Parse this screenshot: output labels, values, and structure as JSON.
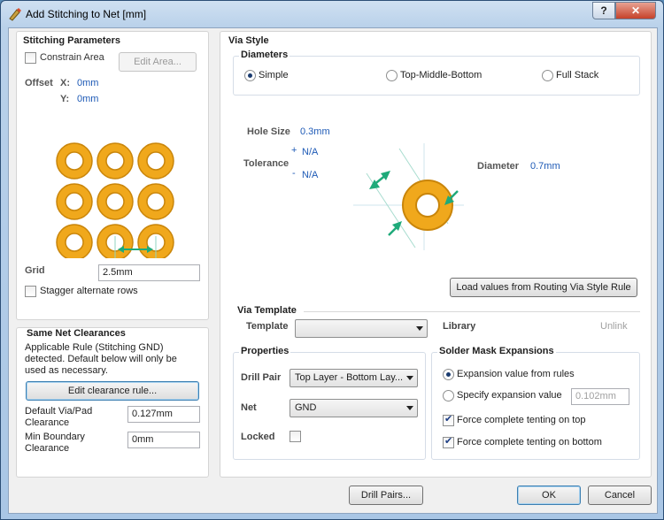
{
  "window": {
    "title": "Add Stitching to Net [mm]",
    "help_label": "?",
    "close_label": "✕"
  },
  "stitching": {
    "title": "Stitching Parameters",
    "constrain_area": "Constrain Area",
    "edit_area": "Edit Area...",
    "offset_label": "Offset",
    "x_label": "X:",
    "x_value": "0mm",
    "y_label": "Y:",
    "y_value": "0mm",
    "grid_label": "Grid",
    "grid_value": "2.5mm",
    "stagger": "Stagger alternate rows"
  },
  "clearances": {
    "title": "Same Net Clearances",
    "rule_text_1": "Applicable Rule (Stitching GND)",
    "rule_text_2": "detected. Default below will only be",
    "rule_text_3": "used as necessary.",
    "edit_rule": "Edit clearance rule...",
    "default_label_1": "Default Via/Pad",
    "default_label_2": "Clearance",
    "default_value": "0.127mm",
    "min_label_1": "Min Boundary",
    "min_label_2": "Clearance",
    "min_value": "0mm"
  },
  "via_style": {
    "title": "Via Style",
    "diameters_title": "Diameters",
    "simple": "Simple",
    "tmb": "Top-Middle-Bottom",
    "full": "Full Stack",
    "hole_size_label": "Hole Size",
    "hole_size_value": "0.3mm",
    "tolerance_label": "Tolerance",
    "tol_plus_sign": "+",
    "tol_plus_value": "N/A",
    "tol_minus_sign": "-",
    "tol_minus_value": "N/A",
    "diameter_label": "Diameter",
    "diameter_value": "0.7mm",
    "load_values": "Load values from Routing Via Style Rule"
  },
  "via_template": {
    "title": "Via Template",
    "template_label": "Template",
    "template_value": "",
    "library_label": "Library",
    "unlink": "Unlink"
  },
  "properties": {
    "title": "Properties",
    "drill_pair_label": "Drill Pair",
    "drill_pair_value": "Top Layer - Bottom Lay...",
    "net_label": "Net",
    "net_value": "GND",
    "locked_label": "Locked"
  },
  "solder_mask": {
    "title": "Solder Mask Expansions",
    "from_rules": "Expansion value from rules",
    "specify": "Specify expansion value",
    "specify_value": "0.102mm",
    "tent_top": "Force complete tenting on top",
    "tent_bottom": "Force complete tenting on bottom"
  },
  "footer": {
    "drill_pairs": "Drill Pairs...",
    "ok": "OK",
    "cancel": "Cancel"
  },
  "colors": {
    "via_ring": "#f0a81c",
    "via_ring_edge": "#c9850a",
    "arrow": "#1faa7a",
    "link_blue": "#1e5ab6"
  }
}
